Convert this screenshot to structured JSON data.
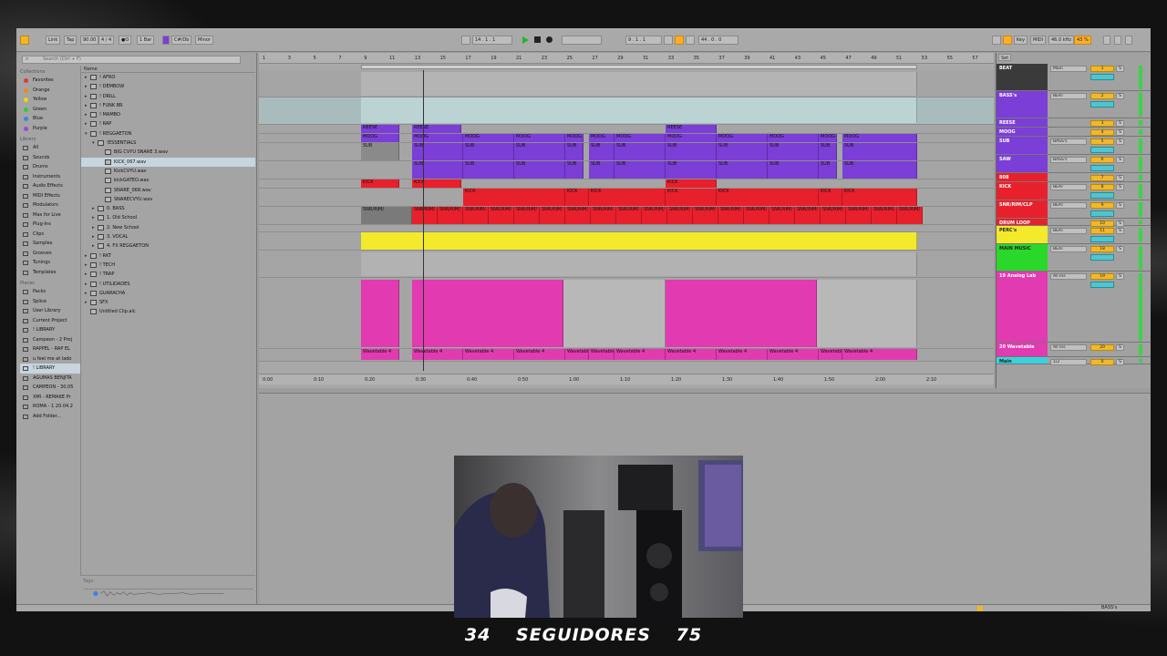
{
  "control_bar": {
    "link": "Link",
    "tap": "Tap",
    "tempo": "90.00",
    "signature": "4 / 4",
    "metronome": "●O",
    "quantize": "1 Bar",
    "key": "C#/Db",
    "scale": "Minor",
    "position": "14 . 1 . 1",
    "loop_start": "9 . 1 . 1",
    "loop_length": "44 . 0 . 0",
    "key_map": "Key",
    "midi_map": "MIDI",
    "sample_rate": "46.0 kHz",
    "cpu": "43 %"
  },
  "browser": {
    "search_placeholder": "Search (Ctrl + F)",
    "collections_label": "Collections",
    "collections": [
      {
        "label": "Favorites",
        "color": "#e23a3a"
      },
      {
        "label": "Orange",
        "color": "#f08a1c"
      },
      {
        "label": "Yellow",
        "color": "#f0d21c"
      },
      {
        "label": "Green",
        "color": "#3cc43c"
      },
      {
        "label": "Blue",
        "color": "#3a86e0"
      },
      {
        "label": "Purple",
        "color": "#9a4ad0"
      }
    ],
    "library_label": "Library",
    "library": [
      "All",
      "Sounds",
      "Drums",
      "Instruments",
      "Audio Effects",
      "MIDI Effects",
      "Modulators",
      "Max for Live",
      "Plug-Ins",
      "Clips",
      "Samples",
      "Grooves",
      "Tunings",
      "Templates"
    ],
    "places_label": "Places",
    "places": [
      "Packs",
      "Splice",
      "User Library",
      "Current Project",
      "! LIBRARY",
      "Campeon - 2 Proj",
      "RAPPEL - RAP EL",
      "u feel me at lado",
      "! LIBRARY",
      "AGUMAS BENJITA",
      "CAMPEON - 30.05",
      "XMI - REMAKE Pr",
      "ROMA - 1 20.04.2",
      "Add Folder..."
    ],
    "name_header": "Name",
    "files": [
      {
        "label": "! AFRO",
        "indent": 0,
        "type": "folder"
      },
      {
        "label": "! DEMBOW",
        "indent": 0,
        "type": "folder"
      },
      {
        "label": "! DRILL",
        "indent": 0,
        "type": "folder"
      },
      {
        "label": "! FUNK BR",
        "indent": 0,
        "type": "folder"
      },
      {
        "label": "! MAMBO",
        "indent": 0,
        "type": "folder"
      },
      {
        "label": "! RAP",
        "indent": 0,
        "type": "folder"
      },
      {
        "label": "! REGGAETON",
        "indent": 0,
        "type": "folder-open"
      },
      {
        "label": "!ESSENTIALS",
        "indent": 1,
        "type": "folder-open"
      },
      {
        "label": "BIG CVYU SNARE 3.wav",
        "indent": 2,
        "type": "wav"
      },
      {
        "label": "KICK_067.wav",
        "indent": 2,
        "type": "wav",
        "selected": true
      },
      {
        "label": "KickCVYU.wav",
        "indent": 2,
        "type": "wav"
      },
      {
        "label": "kickGATEO.wav",
        "indent": 2,
        "type": "wav"
      },
      {
        "label": "SNARE_068.wav",
        "indent": 2,
        "type": "wav"
      },
      {
        "label": "SNARECVYU.wav",
        "indent": 2,
        "type": "wav"
      },
      {
        "label": "0. BASS",
        "indent": 1,
        "type": "folder"
      },
      {
        "label": "1. Old School",
        "indent": 1,
        "type": "folder"
      },
      {
        "label": "2. New School",
        "indent": 1,
        "type": "folder"
      },
      {
        "label": "3. VOCAL",
        "indent": 1,
        "type": "folder"
      },
      {
        "label": "4. FX REGGAETON",
        "indent": 1,
        "type": "folder"
      },
      {
        "label": "! RKT",
        "indent": 0,
        "type": "folder"
      },
      {
        "label": "! TECH",
        "indent": 0,
        "type": "folder"
      },
      {
        "label": "! TRAP",
        "indent": 0,
        "type": "folder"
      },
      {
        "label": "! UTILIDADES",
        "indent": 0,
        "type": "folder"
      },
      {
        "label": "GUARACHA",
        "indent": 0,
        "type": "folder"
      },
      {
        "label": "SFX",
        "indent": 0,
        "type": "folder"
      },
      {
        "label": "Untitled Clip.alc",
        "indent": 0,
        "type": "clip"
      }
    ],
    "tags_label": "Tags:"
  },
  "ruler": [
    "1",
    "3",
    "5",
    "7",
    "9",
    "11",
    "13",
    "15",
    "17",
    "19",
    "21",
    "23",
    "25",
    "27",
    "29",
    "31",
    "33",
    "35",
    "37",
    "39",
    "41",
    "43",
    "45",
    "47",
    "49",
    "51",
    "53",
    "55",
    "57"
  ],
  "timeline": [
    "0:00",
    "0:10",
    "0:20",
    "0:30",
    "0:40",
    "0:50",
    "1:00",
    "1:10",
    "1:20",
    "1:30",
    "1:40",
    "1:50",
    "2:00",
    "2:10"
  ],
  "arrangement": {
    "clips": {
      "reese": "REESE",
      "moog": "MOOG",
      "sub": "SUB",
      "kick": "KICK",
      "snr": "SNR/RIM/CLP",
      "short_snr": "SNR/RIM/",
      "wavetable": "Wavetable 4",
      "bw": "BW"
    }
  },
  "mixer": {
    "tracks": [
      {
        "name": "BEAT",
        "color": "#3a3a3a",
        "route": "Main",
        "num": "1"
      },
      {
        "name": "BASS's",
        "color": "#7b3ed6",
        "route": "BEAT",
        "num": "2"
      },
      {
        "name": "REESE",
        "color": "#7b3ed6",
        "route": "",
        "num": "3"
      },
      {
        "name": "MOOG",
        "color": "#7b3ed6",
        "route": "",
        "num": "4"
      },
      {
        "name": "SUB",
        "color": "#7b3ed6",
        "route": "BASS's",
        "num": "5"
      },
      {
        "name": "SAW",
        "color": "#7b3ed6",
        "route": "BASS's",
        "num": "6"
      },
      {
        "name": "808",
        "color": "#e8202c",
        "route": "",
        "num": "7"
      },
      {
        "name": "KICK",
        "color": "#e8202c",
        "route": "BEAT",
        "num": "8"
      },
      {
        "name": "SNR/RIM/CLP",
        "color": "#e8202c",
        "route": "BEAT",
        "num": "9"
      },
      {
        "name": "DRUM LOOP",
        "color": "#e8202c",
        "route": "",
        "num": "10"
      },
      {
        "name": "PERC's",
        "color": "#f2ea2a",
        "route": "BEAT",
        "num": "11"
      },
      {
        "name": "MAIN MUSIC",
        "color": "#2ad82a",
        "route": "BEAT",
        "num": "18"
      },
      {
        "name": "19 Analog Lab",
        "color": "#e23ab0",
        "route": "All Ins",
        "num": "19"
      },
      {
        "name": "20 Wavetable",
        "color": "#e23ab0",
        "route": "All Ins",
        "num": "20"
      },
      {
        "name": "Main",
        "color": "#3ad2dc",
        "route": "1/2",
        "num": "0"
      }
    ],
    "set_label": "Set",
    "routing_extra": [
      "All Channe",
      "In",
      "Auto",
      "Off",
      "MAIN MUSIC"
    ],
    "sb_s": "S",
    "sb_c": "C"
  },
  "status": {
    "right_label": "BASS's",
    "page_fraction": "1/1"
  },
  "overlay": {
    "left_number": "34",
    "label": "SEGUIDORES",
    "right_number": "75"
  },
  "colors": {
    "purple": "#7b3ed6",
    "red": "#e8202c",
    "yellow": "#f2ea2a",
    "pink": "#e23ab0",
    "teal_clip": "#bcd3d4",
    "accent_orange": "#f2b624"
  }
}
